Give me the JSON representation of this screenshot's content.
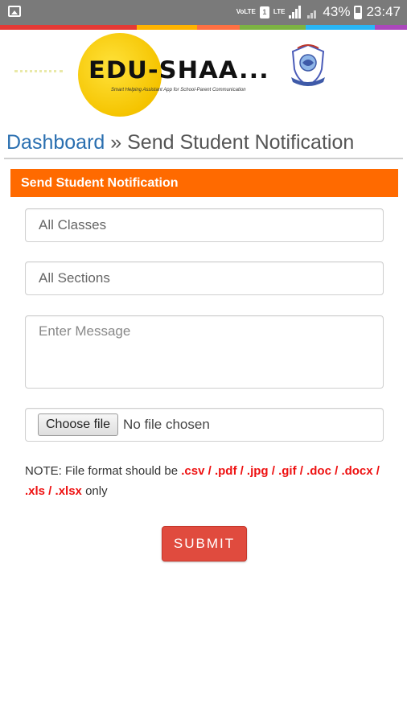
{
  "status_bar": {
    "volte_label": "VoLTE",
    "lte_label": "LTE",
    "sim_label": "1",
    "battery": "43%",
    "time": "23:47"
  },
  "colors": {
    "accent_orange": "#ff6a00",
    "submit_red": "#e04b3e",
    "link_blue": "#2a6fb0",
    "format_red": "#ee1111",
    "stripe": [
      "#e53935",
      "#ffb300",
      "#ff7043",
      "#7cb342",
      "#29b6f6",
      "#ab47bc"
    ]
  },
  "logo": {
    "name": "EDU-SHAA...",
    "tagline": "Smart Helping Assistant App for School-Parent Communication"
  },
  "breadcrumb": {
    "home": "Dashboard",
    "separator": "»",
    "current": "Send Student Notification"
  },
  "form": {
    "heading": "Send Student Notification",
    "classes_value": "All Classes",
    "sections_value": "All Sections",
    "message_placeholder": "Enter Message",
    "file_button": "Choose file",
    "file_status": "No file chosen",
    "note_prefix": "NOTE: File format should be",
    "formats_line1": ".csv / .pdf / .jpg / .gif / .doc /",
    "formats_line2": ".docx / .xls / .xlsx",
    "note_suffix": "only",
    "submit_label": "SUBMIT"
  },
  "icons": {
    "gallery": "gallery-notification-icon",
    "signal": "signal-strength-icon",
    "battery": "battery-icon",
    "emblem": "school-crest-icon"
  }
}
